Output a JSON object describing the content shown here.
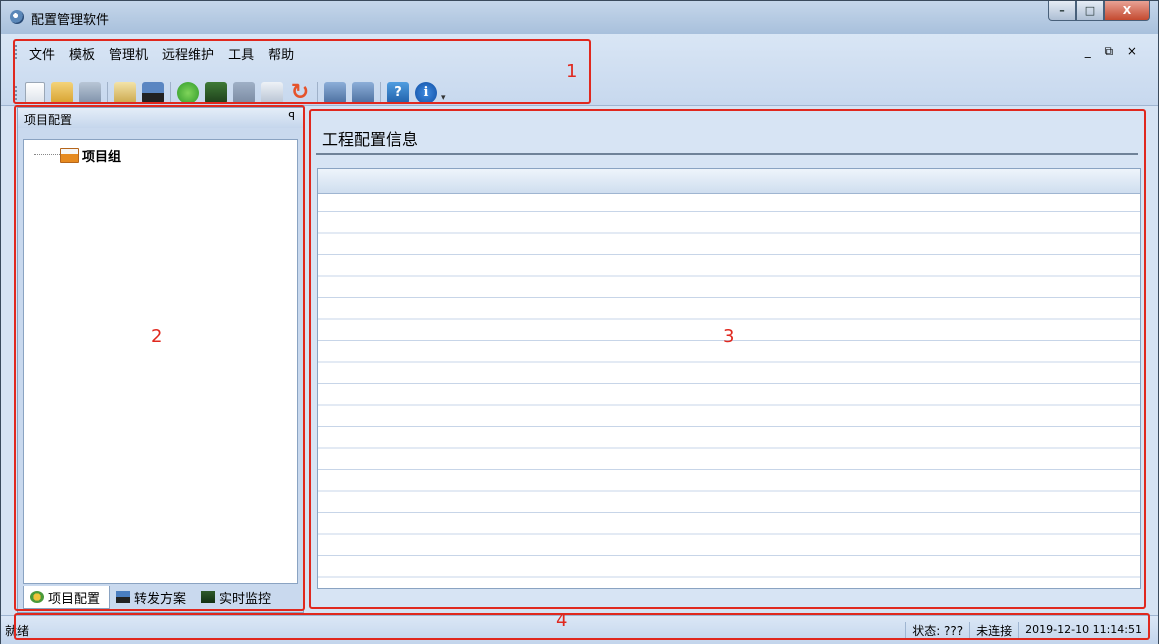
{
  "window": {
    "title": "配置管理软件",
    "controls": {
      "minimize": "–",
      "maximize": "□",
      "close": "X"
    }
  },
  "menu": [
    "文件",
    "模板",
    "管理机",
    "远程维护",
    "工具",
    "帮助"
  ],
  "mdi_controls": "_ ⧉ ×",
  "toolbar": {
    "icons": [
      "new-file-icon",
      "open-folder-icon",
      "save-icon",
      "book-icon",
      "link-icon",
      "forward-icon",
      "monitor-icon",
      "monitor-disabled-icon",
      "gear-icon",
      "refresh-icon",
      "ssh-icon",
      "ftp-icon",
      "help-icon",
      "info-icon"
    ],
    "help_glyph": "?",
    "info_glyph": "i",
    "refresh_glyph": "↻",
    "overflow": "▾"
  },
  "left_panel": {
    "title": "项目配置",
    "pin": "ꟼ",
    "tree_root": "项目组",
    "tabs": [
      "项目配置",
      "转发方案",
      "实时监控"
    ]
  },
  "right_panel": {
    "title": "工程配置信息"
  },
  "status_bar": {
    "ready": "就绪",
    "state": "状态: ???",
    "connection": "未连接",
    "datetime": "2019-12-10 11:14:51"
  },
  "annotations": [
    "1",
    "2",
    "3",
    "4"
  ],
  "colors": {
    "annotation": "#e0281e",
    "panel": "#d7e4f4"
  }
}
